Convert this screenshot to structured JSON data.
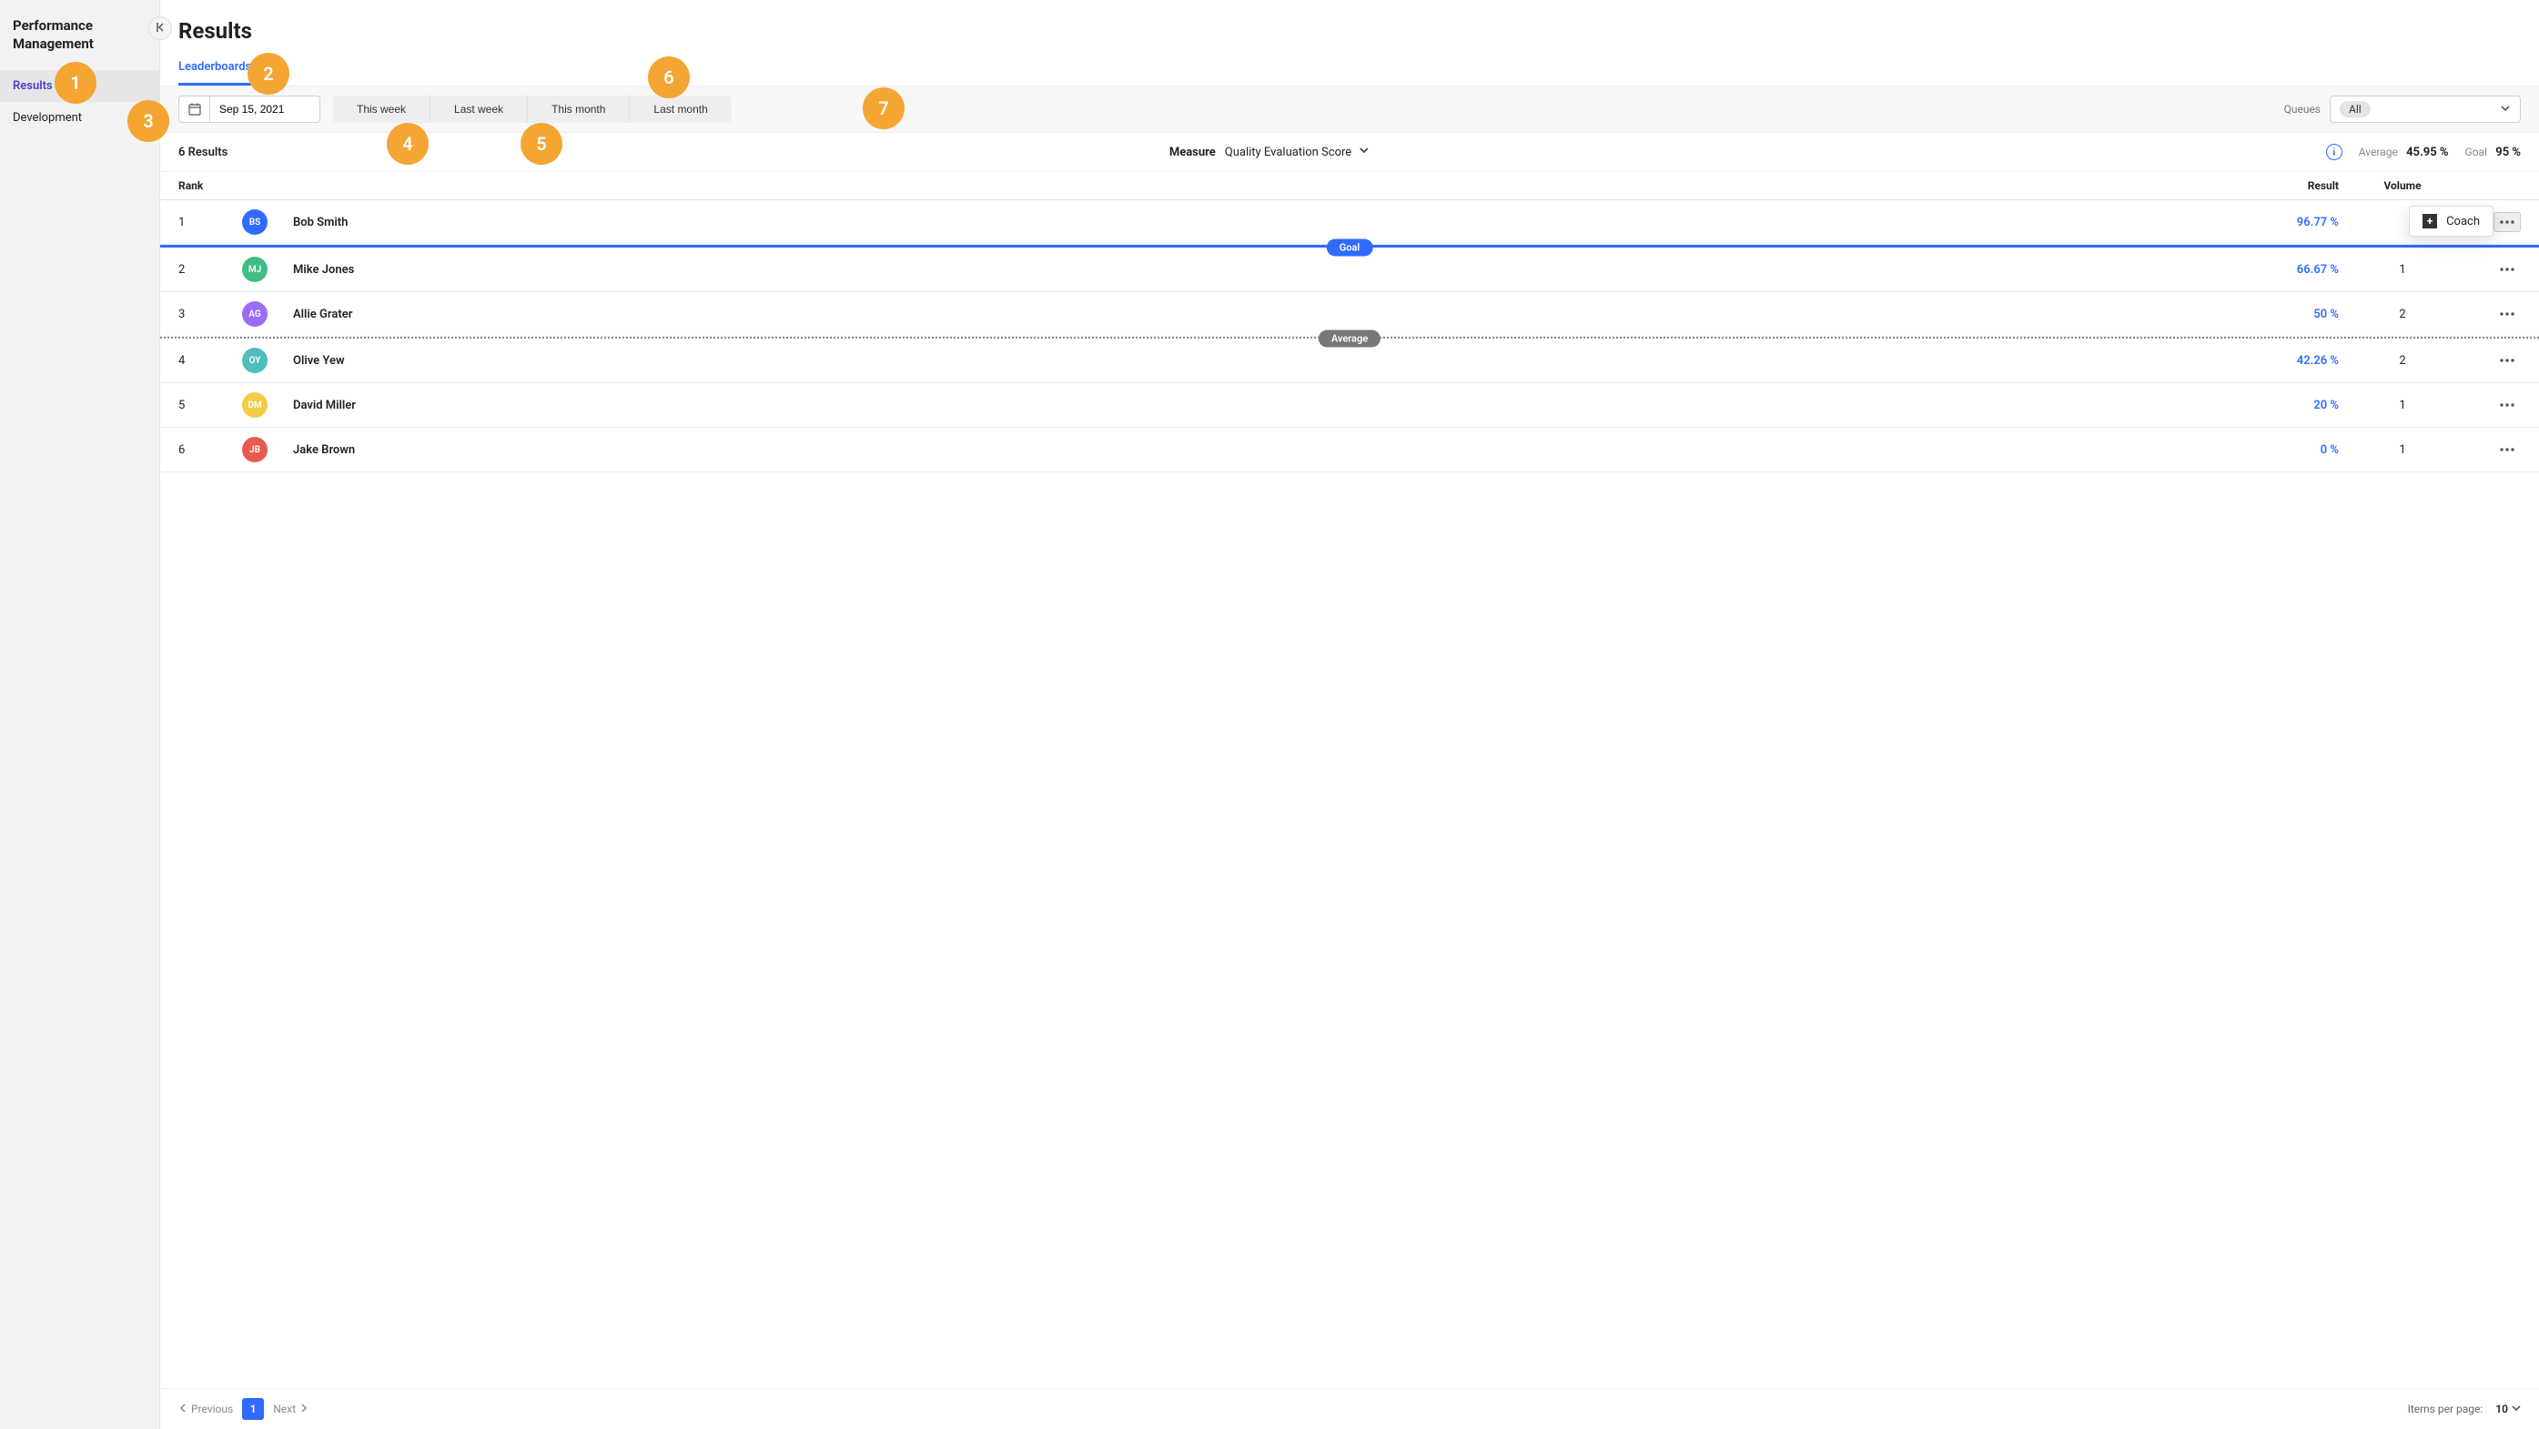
{
  "sidebar": {
    "title": "Performance Management",
    "items": [
      {
        "label": "Results",
        "active": true
      },
      {
        "label": "Development",
        "active": false
      }
    ]
  },
  "page": {
    "title": "Results"
  },
  "tabs": [
    {
      "label": "Leaderboards",
      "active": true
    }
  ],
  "filters": {
    "date": "Sep 15, 2021",
    "ranges": [
      "This week",
      "Last week",
      "This month",
      "Last month"
    ],
    "queues_label": "Queues",
    "queues_selected": "All"
  },
  "summary": {
    "results_count": "6 Results",
    "measure_label": "Measure",
    "measure_value": "Quality Evaluation Score",
    "average_label": "Average",
    "average_value": "45.95 %",
    "goal_label": "Goal",
    "goal_value": "95 %"
  },
  "table": {
    "columns": {
      "rank": "Rank",
      "result": "Result",
      "volume": "Volume"
    },
    "rows": [
      {
        "rank": "1",
        "initials": "BS",
        "color": "#2f6bff",
        "name": "Bob Smith",
        "result": "96.77 %",
        "volume": ""
      },
      {
        "rank": "2",
        "initials": "MJ",
        "color": "#3fbf85",
        "name": "Mike Jones",
        "result": "66.67 %",
        "volume": "1"
      },
      {
        "rank": "3",
        "initials": "AG",
        "color": "#9b6cf5",
        "name": "Allie Grater",
        "result": "50 %",
        "volume": "2"
      },
      {
        "rank": "4",
        "initials": "OY",
        "color": "#4fbdbd",
        "name": "Olive Yew",
        "result": "42.26 %",
        "volume": "2"
      },
      {
        "rank": "5",
        "initials": "DM",
        "color": "#f2cc46",
        "name": "David Miller",
        "result": "20 %",
        "volume": "1"
      },
      {
        "rank": "6",
        "initials": "JB",
        "color": "#e85a4f",
        "name": "Jake Brown",
        "result": "0 %",
        "volume": "1"
      }
    ],
    "goal_badge": "Goal",
    "average_badge": "Average",
    "popover": {
      "coach_label": "Coach"
    }
  },
  "footer": {
    "previous": "Previous",
    "next": "Next",
    "page": "1",
    "ipp_label": "Items per page:",
    "ipp_value": "10"
  },
  "callouts": [
    "1",
    "2",
    "3",
    "4",
    "5",
    "6",
    "7"
  ]
}
